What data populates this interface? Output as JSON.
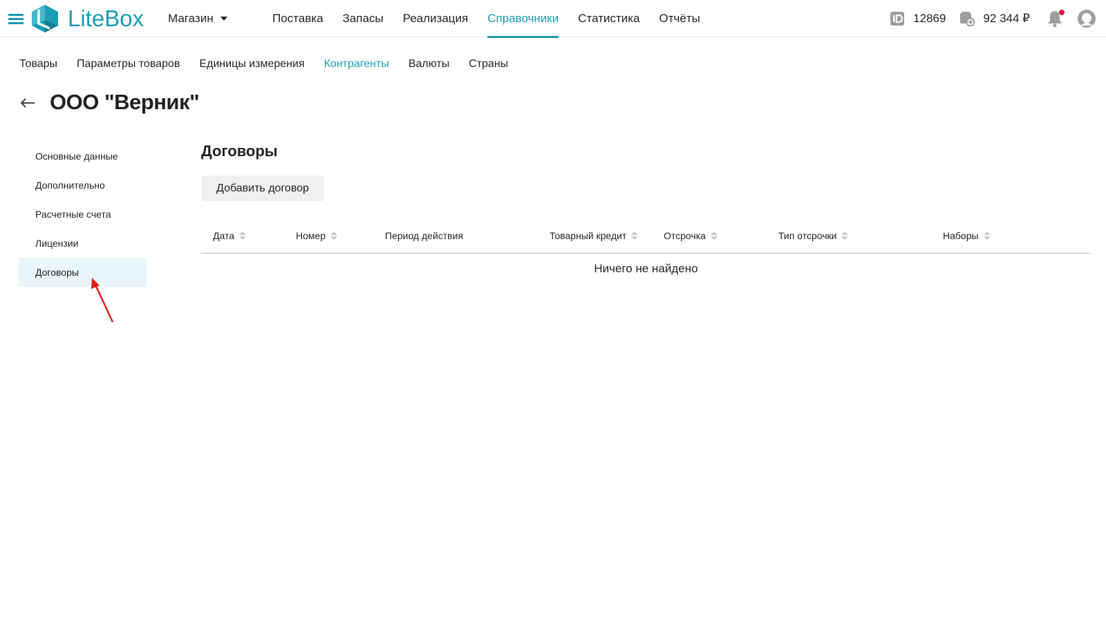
{
  "brand": {
    "name": "LiteBox",
    "color": "#1a9cb4"
  },
  "header": {
    "store_label": "Магазин",
    "nav": [
      {
        "label": "Поставка"
      },
      {
        "label": "Запасы"
      },
      {
        "label": "Реализация"
      },
      {
        "label": "Справочники",
        "active": true
      },
      {
        "label": "Статистика"
      },
      {
        "label": "Отчёты"
      }
    ],
    "account_id": "12869",
    "balance": "92 344 ₽",
    "has_notifications": true
  },
  "subnav": [
    {
      "label": "Товары"
    },
    {
      "label": "Параметры товаров"
    },
    {
      "label": "Единицы измерения"
    },
    {
      "label": "Контрагенты",
      "active": true
    },
    {
      "label": "Валюты"
    },
    {
      "label": "Страны"
    }
  ],
  "page": {
    "title": "ООО \"Верник\""
  },
  "sidemenu": [
    {
      "label": "Основные данные"
    },
    {
      "label": "Дополнительно"
    },
    {
      "label": "Расчетные счета"
    },
    {
      "label": "Лицензии"
    },
    {
      "label": "Договоры",
      "active": true
    }
  ],
  "content": {
    "section_title": "Договоры",
    "add_button": "Добавить договор",
    "columns": [
      {
        "label": "Дата",
        "sortable": true
      },
      {
        "label": "Номер",
        "sortable": true
      },
      {
        "label": "Период действия",
        "sortable": false
      },
      {
        "label": "Товарный кредит",
        "sortable": true
      },
      {
        "label": "Отсрочка",
        "sortable": true
      },
      {
        "label": "Тип отсрочки",
        "sortable": true
      },
      {
        "label": "Наборы",
        "sortable": true
      }
    ],
    "empty_text": "Ничего не найдено"
  },
  "annotation_color": "#e01b1b"
}
